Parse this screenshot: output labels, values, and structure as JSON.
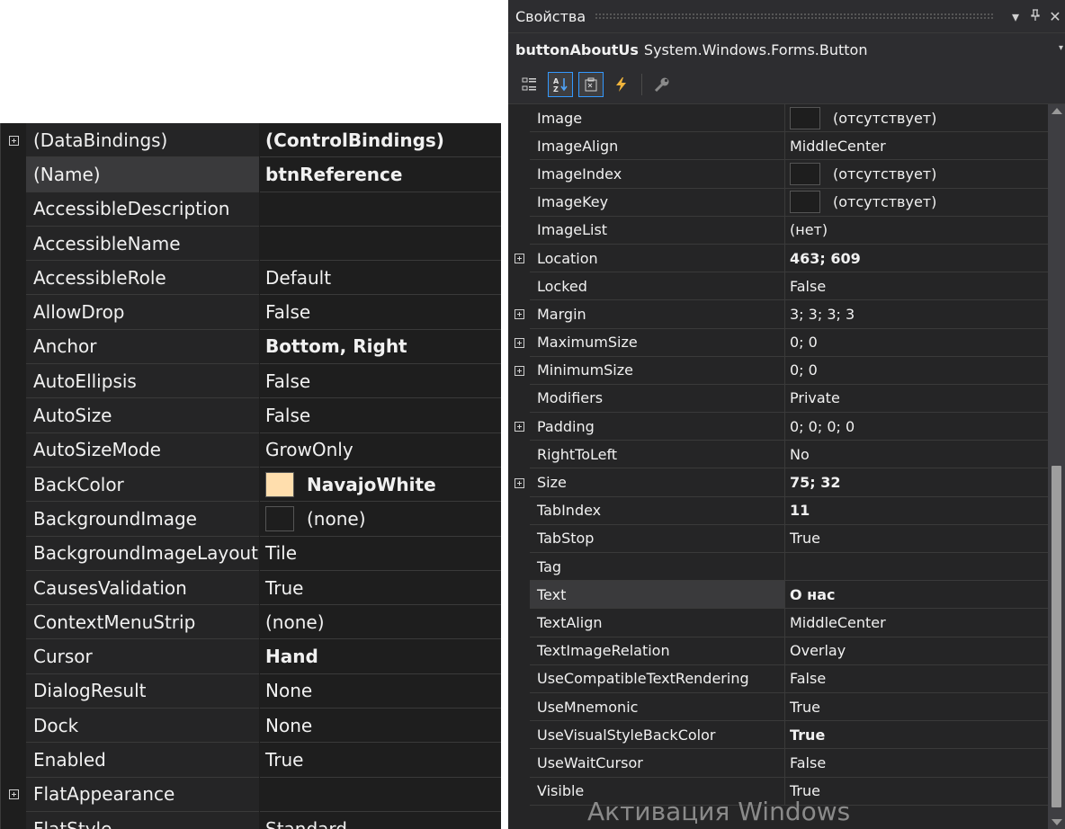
{
  "left_grid": {
    "rows": [
      {
        "name": "(DataBindings)",
        "value": "(ControlBindings)",
        "expandable": true,
        "bold": true
      },
      {
        "name": "(Name)",
        "value": "btnReference",
        "bold": true,
        "selected": true
      },
      {
        "name": "AccessibleDescription",
        "value": ""
      },
      {
        "name": "AccessibleName",
        "value": ""
      },
      {
        "name": "AccessibleRole",
        "value": "Default"
      },
      {
        "name": "AllowDrop",
        "value": "False"
      },
      {
        "name": "Anchor",
        "value": "Bottom, Right",
        "bold": true
      },
      {
        "name": "AutoEllipsis",
        "value": "False"
      },
      {
        "name": "AutoSize",
        "value": "False"
      },
      {
        "name": "AutoSizeMode",
        "value": "GrowOnly"
      },
      {
        "name": "BackColor",
        "value": "NavajoWhite",
        "bold": true,
        "swatch": "#ffdead"
      },
      {
        "name": "BackgroundImage",
        "value": "(none)",
        "swatch": "#1e1e1e"
      },
      {
        "name": "BackgroundImageLayout",
        "value": "Tile"
      },
      {
        "name": "CausesValidation",
        "value": "True"
      },
      {
        "name": "ContextMenuStrip",
        "value": "(none)"
      },
      {
        "name": "Cursor",
        "value": "Hand",
        "bold": true
      },
      {
        "name": "DialogResult",
        "value": "None"
      },
      {
        "name": "Dock",
        "value": "None"
      },
      {
        "name": "Enabled",
        "value": "True"
      },
      {
        "name": "FlatAppearance",
        "value": "",
        "expandable": true
      },
      {
        "name": "FlatStyle",
        "value": "Standard"
      }
    ]
  },
  "properties_window": {
    "title": "Свойства",
    "title_buttons": {
      "dropdown": "▾",
      "pin": "ᵠ",
      "close": "✕"
    },
    "object_name": "buttonAboutUs",
    "object_type": "System.Windows.Forms.Button",
    "object_dropdown": "▾",
    "toolbar": [
      {
        "icon": "categorized-icon",
        "active": false
      },
      {
        "icon": "alphabetical-icon",
        "active": true
      },
      {
        "icon": "properties-icon",
        "active": true
      },
      {
        "icon": "events-icon",
        "active": false
      },
      {
        "icon": "property-pages-icon",
        "active": false
      }
    ],
    "rows": [
      {
        "name": "Image",
        "value": "(отсутствует)",
        "swatch": true
      },
      {
        "name": "ImageAlign",
        "value": "MiddleCenter"
      },
      {
        "name": "ImageIndex",
        "value": "(отсутствует)",
        "swatch": true
      },
      {
        "name": "ImageKey",
        "value": "(отсутствует)",
        "swatch": true
      },
      {
        "name": "ImageList",
        "value": "(нет)"
      },
      {
        "name": "Location",
        "value": "463; 609",
        "expandable": true,
        "bold": true
      },
      {
        "name": "Locked",
        "value": "False"
      },
      {
        "name": "Margin",
        "value": "3; 3; 3; 3",
        "expandable": true
      },
      {
        "name": "MaximumSize",
        "value": "0; 0",
        "expandable": true
      },
      {
        "name": "MinimumSize",
        "value": "0; 0",
        "expandable": true
      },
      {
        "name": "Modifiers",
        "value": "Private"
      },
      {
        "name": "Padding",
        "value": "0; 0; 0; 0",
        "expandable": true
      },
      {
        "name": "RightToLeft",
        "value": "No"
      },
      {
        "name": "Size",
        "value": "75; 32",
        "expandable": true,
        "bold": true
      },
      {
        "name": "TabIndex",
        "value": "11",
        "bold": true
      },
      {
        "name": "TabStop",
        "value": "True"
      },
      {
        "name": "Tag",
        "value": ""
      },
      {
        "name": "Text",
        "value": "О нас",
        "bold": true,
        "selected": true
      },
      {
        "name": "TextAlign",
        "value": "MiddleCenter"
      },
      {
        "name": "TextImageRelation",
        "value": "Overlay"
      },
      {
        "name": "UseCompatibleTextRendering",
        "value": "False"
      },
      {
        "name": "UseMnemonic",
        "value": "True"
      },
      {
        "name": "UseVisualStyleBackColor",
        "value": "True",
        "bold": true
      },
      {
        "name": "UseWaitCursor",
        "value": "False"
      },
      {
        "name": "Visible",
        "value": "True"
      }
    ]
  },
  "watermark": "Активация Windows"
}
